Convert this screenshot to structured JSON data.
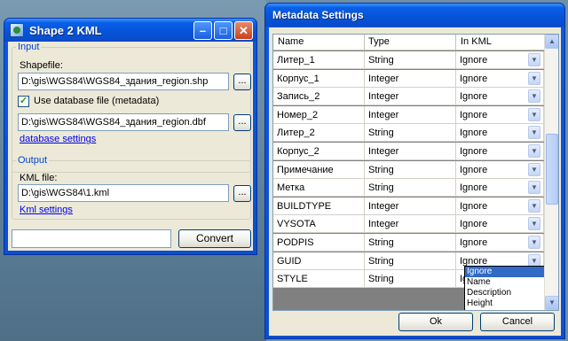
{
  "shape2kml": {
    "title": "Shape 2 KML",
    "input_legend": "Input",
    "shapefile_label": "Shapefile:",
    "shapefile_value": "D:\\gis\\WGS84\\WGS84_здания_region.shp",
    "browse_label": "...",
    "use_db_label": "Use database file (metadata)",
    "use_db_checked": true,
    "dbf_value": "D:\\gis\\WGS84\\WGS84_здания_region.dbf",
    "database_settings_link": "database settings",
    "output_legend": "Output",
    "kml_label": "KML file:",
    "kml_value": "D:\\gis\\WGS84\\1.kml",
    "kml_settings_link": "Kml settings",
    "status_value": "",
    "convert_label": "Convert"
  },
  "metadata": {
    "title": "Metadata Settings",
    "columns": [
      "Name",
      "Type",
      "In KML"
    ],
    "rows": [
      {
        "name": "Литер_1",
        "type": "String",
        "in_kml": "Ignore"
      },
      {
        "name": "Корпус_1",
        "type": "Integer",
        "in_kml": "Ignore"
      },
      {
        "name": "Запись_2",
        "type": "Integer",
        "in_kml": "Ignore"
      },
      {
        "name": "Номер_2",
        "type": "Integer",
        "in_kml": "Ignore"
      },
      {
        "name": "Литер_2",
        "type": "String",
        "in_kml": "Ignore"
      },
      {
        "name": "Корпус_2",
        "type": "Integer",
        "in_kml": "Ignore"
      },
      {
        "name": "Примечание",
        "type": "String",
        "in_kml": "Ignore"
      },
      {
        "name": "Метка",
        "type": "String",
        "in_kml": "Ignore"
      },
      {
        "name": "BUILDTYPE",
        "type": "Integer",
        "in_kml": "Ignore"
      },
      {
        "name": "VYSOTA",
        "type": "Integer",
        "in_kml": "Ignore"
      },
      {
        "name": "PODPIS",
        "type": "String",
        "in_kml": "Ignore"
      },
      {
        "name": "GUID",
        "type": "String",
        "in_kml": "Ignore"
      },
      {
        "name": "STYLE",
        "type": "String",
        "in_kml": "Ignore"
      }
    ],
    "dropdown_options": [
      "Ignore",
      "Name",
      "Description",
      "Height"
    ],
    "ok_label": "Ok",
    "cancel_label": "Cancel"
  }
}
